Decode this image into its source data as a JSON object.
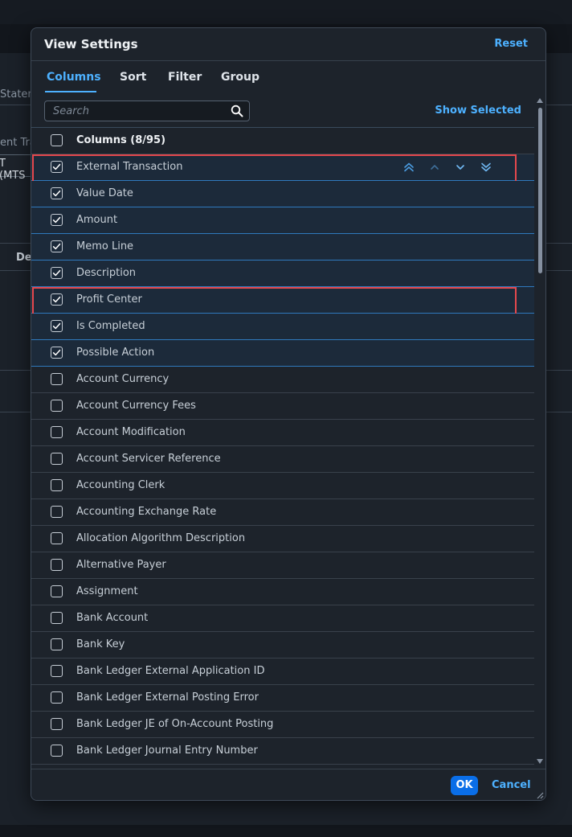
{
  "background": {
    "text_statement": "Staten",
    "text_tra": "ent Tra",
    "input_value": "T (MTS",
    "text_de": "De"
  },
  "dialog": {
    "title": "View Settings",
    "reset_label": "Reset",
    "tabs": [
      {
        "label": "Columns",
        "active": true
      },
      {
        "label": "Sort",
        "active": false
      },
      {
        "label": "Filter",
        "active": false
      },
      {
        "label": "Group",
        "active": false
      }
    ],
    "search_placeholder": "Search",
    "show_selected_label": "Show Selected",
    "columns_header": "Columns (8/95)",
    "columns": [
      {
        "label": "External Transaction",
        "checked": true,
        "highlighted": true,
        "show_move": true
      },
      {
        "label": "Value Date",
        "checked": true
      },
      {
        "label": "Amount",
        "checked": true
      },
      {
        "label": "Memo Line",
        "checked": true
      },
      {
        "label": "Description",
        "checked": true
      },
      {
        "label": "Profit Center",
        "checked": true,
        "highlighted": true
      },
      {
        "label": "Is Completed",
        "checked": true
      },
      {
        "label": "Possible Action",
        "checked": true
      },
      {
        "label": "Account Currency",
        "checked": false
      },
      {
        "label": "Account Currency Fees",
        "checked": false
      },
      {
        "label": "Account Modification",
        "checked": false
      },
      {
        "label": "Account Servicer Reference",
        "checked": false
      },
      {
        "label": "Accounting Clerk",
        "checked": false
      },
      {
        "label": "Accounting Exchange Rate",
        "checked": false
      },
      {
        "label": "Allocation Algorithm Description",
        "checked": false
      },
      {
        "label": "Alternative Payer",
        "checked": false
      },
      {
        "label": "Assignment",
        "checked": false
      },
      {
        "label": "Bank Account",
        "checked": false
      },
      {
        "label": "Bank Key",
        "checked": false
      },
      {
        "label": "Bank Ledger External Application ID",
        "checked": false
      },
      {
        "label": "Bank Ledger External Posting Error",
        "checked": false
      },
      {
        "label": "Bank Ledger JE of On-Account Posting",
        "checked": false
      },
      {
        "label": "Bank Ledger Journal Entry Number",
        "checked": false
      }
    ],
    "move_icons": [
      "move-to-top-icon",
      "move-up-icon",
      "move-down-icon",
      "move-to-bottom-icon"
    ],
    "ok_label": "OK",
    "cancel_label": "Cancel"
  },
  "colors": {
    "accent": "#4db1ff",
    "primary_button": "#0a6ee8",
    "highlight_border": "#e5484d",
    "selected_row_bg": "#1c2a3a"
  }
}
